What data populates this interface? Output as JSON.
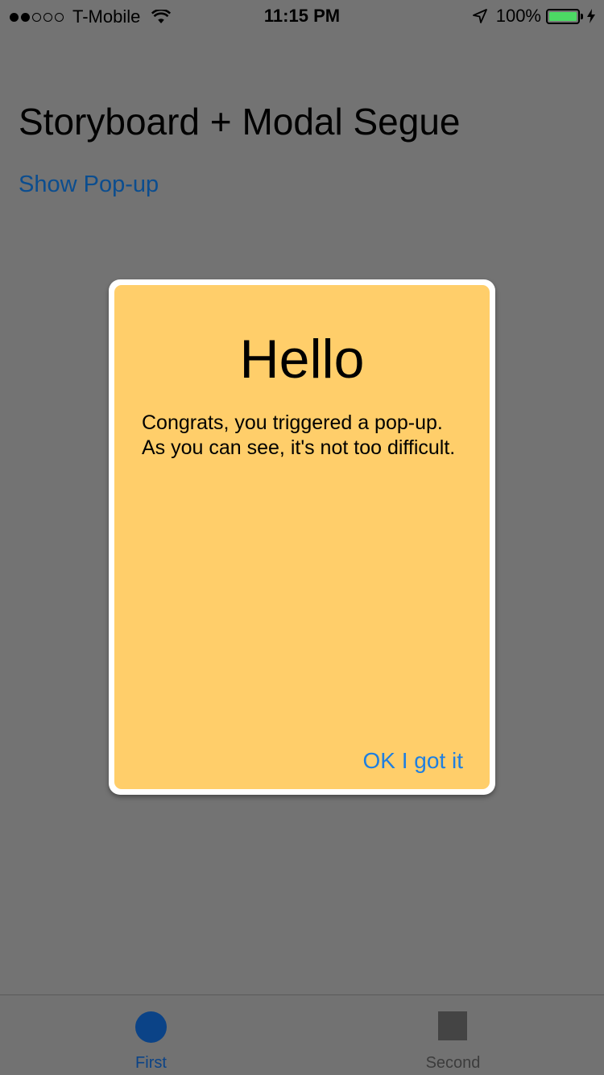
{
  "status_bar": {
    "signal_dots": [
      true,
      true,
      false,
      false,
      false
    ],
    "carrier": "T-Mobile",
    "time": "11:15 PM",
    "battery_percent": "100%",
    "battery_level": 1.0,
    "icons": [
      "wifi-icon",
      "location-arrow-icon",
      "battery-icon",
      "charging-bolt-icon"
    ]
  },
  "page": {
    "title": "Storyboard + Modal Segue",
    "show_popup_link": "Show Pop-up",
    "link_color": "#0b4d8f",
    "dimmed_background": "#737373"
  },
  "popup": {
    "title": "Hello",
    "message": "Congrats, you triggered a pop-up. As you can see, it's not too difficult.",
    "ok_button": "OK I got it",
    "card_color": "#ffce6a",
    "button_color": "#1f7fe0"
  },
  "tab_bar": {
    "tabs": [
      {
        "label": "First",
        "icon": "circle-icon",
        "selected": true
      },
      {
        "label": "Second",
        "icon": "square-icon",
        "selected": false
      }
    ]
  }
}
